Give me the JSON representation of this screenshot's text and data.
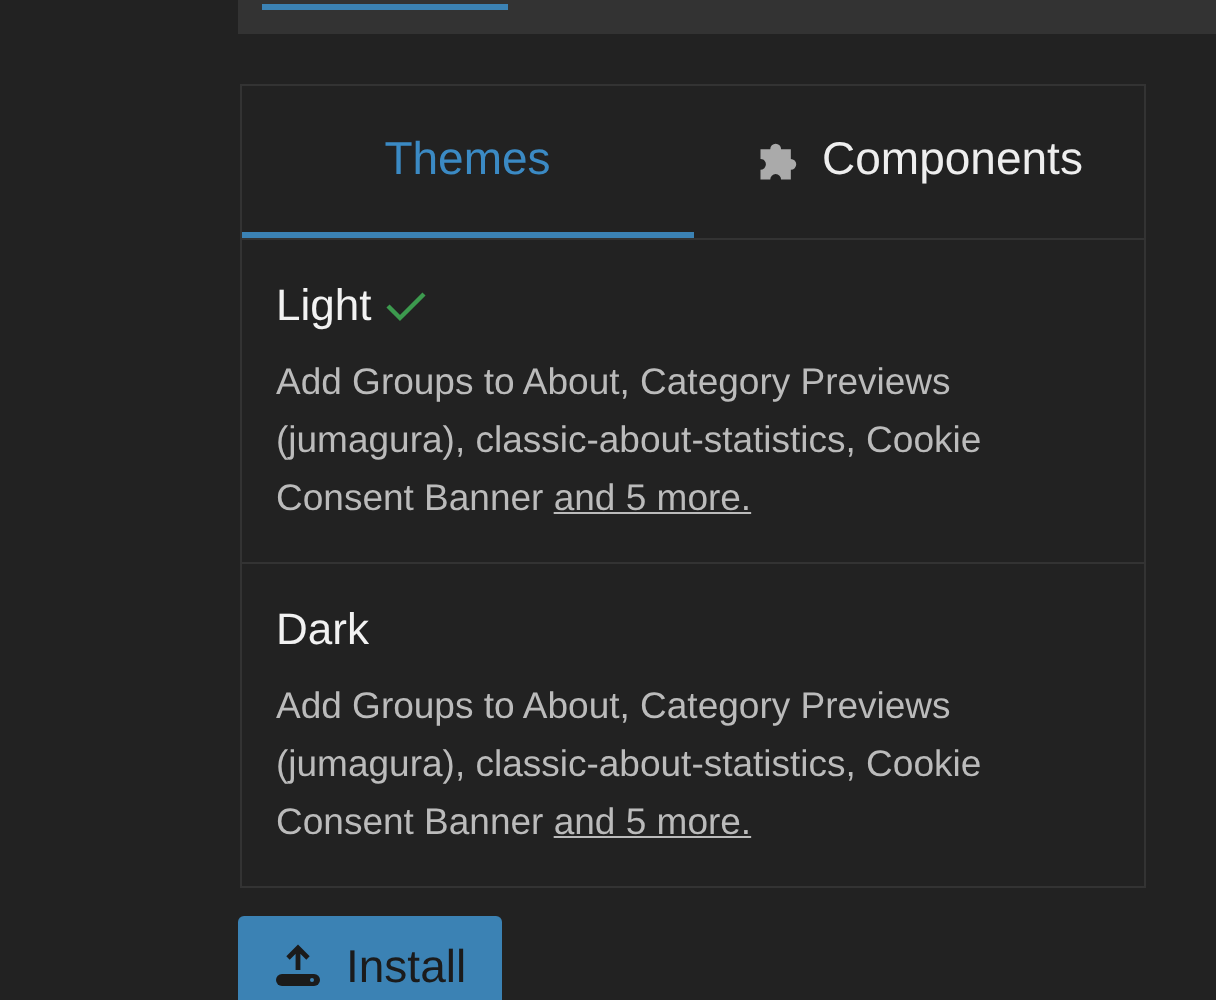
{
  "tabs": [
    {
      "label": "Themes",
      "selected": true,
      "kind": "plain"
    },
    {
      "label": "Components",
      "selected": false,
      "kind": "component"
    }
  ],
  "themes": [
    {
      "name": "Light",
      "active": true,
      "description": "Add Groups to About, Category Previews (jumagura), classic-about-statistics, Cookie Consent Banner",
      "more_link": "and 5 more."
    },
    {
      "name": "Dark",
      "active": false,
      "description": "Add Groups to About, Category Previews (jumagura), classic-about-statistics, Cookie Consent Banner",
      "more_link": "and 5 more."
    }
  ],
  "install_button": {
    "label": "Install"
  }
}
